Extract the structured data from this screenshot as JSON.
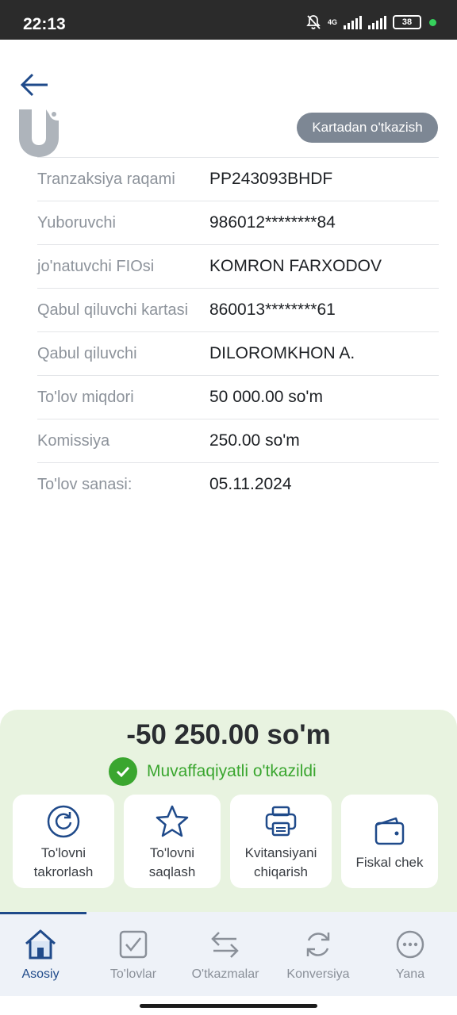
{
  "status_bar": {
    "time": "22:13",
    "network": "4G",
    "battery": "38"
  },
  "header": {
    "transfer_type": "Kartadan o'tkazish"
  },
  "details": [
    {
      "label": "Tranzaksiya raqami",
      "value": "PP243093BHDF"
    },
    {
      "label": "Yuboruvchi",
      "value": "986012********84"
    },
    {
      "label": "jo'natuvchi FIOsi",
      "value": "KOMRON FARXODOV"
    },
    {
      "label": "Qabul qiluvchi kartasi",
      "value": "860013********61"
    },
    {
      "label": "Qabul qiluvchi",
      "value": "DILOROMKHON A."
    },
    {
      "label": "To'lov miqdori",
      "value": "50 000.00 so'm"
    },
    {
      "label": "Komissiya",
      "value": "250.00 so'm"
    },
    {
      "label": "To'lov sanasi:",
      "value": "05.11.2024"
    }
  ],
  "summary": {
    "amount": "-50 250.00 so'm",
    "status": "Muvaffaqiyatli o'tkazildi"
  },
  "actions": [
    {
      "label": "To'lovni\ntakrorlash",
      "icon": "repeat-icon"
    },
    {
      "label": "To'lovni\nsaqlash",
      "icon": "star-icon"
    },
    {
      "label": "Kvitansiyani\nchiqarish",
      "icon": "printer-icon"
    },
    {
      "label": "Fiskal chek",
      "icon": "wallet-icon"
    }
  ],
  "nav": [
    {
      "label": "Asosiy",
      "icon": "home-icon",
      "active": true
    },
    {
      "label": "To'lovlar",
      "icon": "checkbox-icon"
    },
    {
      "label": "O'tkazmalar",
      "icon": "transfer-arrows-icon"
    },
    {
      "label": "Konversiya",
      "icon": "refresh-icon"
    },
    {
      "label": "Yana",
      "icon": "more-icon"
    }
  ],
  "colors": {
    "accent": "#1f4a8a",
    "success": "#3aa62f",
    "badge": "#7d8794",
    "summary_bg": "#e8f3e0"
  }
}
